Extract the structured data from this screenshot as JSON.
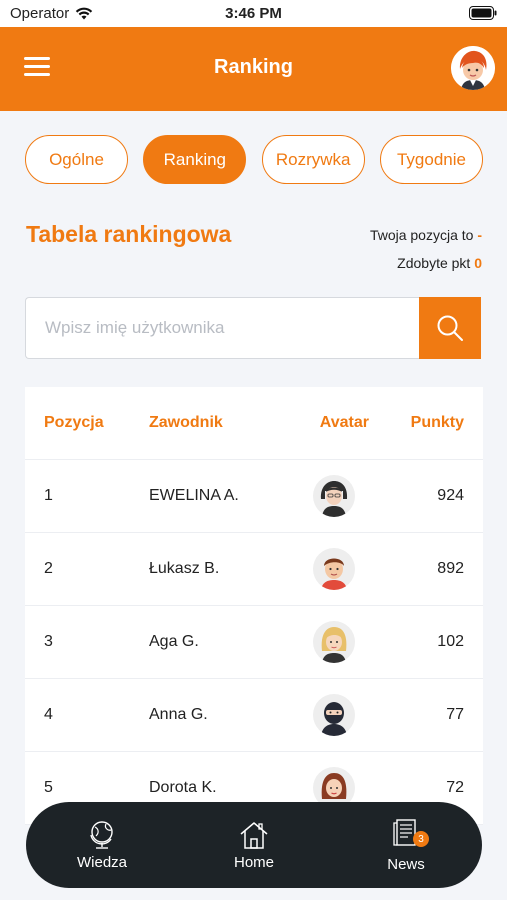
{
  "status_bar": {
    "carrier": "Operator",
    "time": "3:46 PM"
  },
  "header": {
    "title": "Ranking"
  },
  "tabs": [
    {
      "label": "Ogólne",
      "active": false
    },
    {
      "label": "Ranking",
      "active": true
    },
    {
      "label": "Rozrywka",
      "active": false
    },
    {
      "label": "Tygodnie",
      "active": false
    }
  ],
  "section": {
    "title": "Tabela rankingowa",
    "position_label": "Twoja pozycja to",
    "position_value": "-",
    "points_label": "Zdobyte pkt",
    "points_value": "0"
  },
  "search": {
    "placeholder": "Wpisz imię użytkownika",
    "value": ""
  },
  "table": {
    "headers": {
      "position": "Pozycja",
      "player": "Zawodnik",
      "avatar": "Avatar",
      "points": "Punkty"
    },
    "rows": [
      {
        "position": "1",
        "player": "EWELINA A.",
        "points": "924",
        "avatar": "woman-dark-hair-avatar"
      },
      {
        "position": "2",
        "player": "Łukasz B.",
        "points": "892",
        "avatar": "man-red-hair-avatar"
      },
      {
        "position": "3",
        "player": "Aga G.",
        "points": "102",
        "avatar": "woman-blonde-avatar"
      },
      {
        "position": "4",
        "player": "Anna G.",
        "points": "77",
        "avatar": "ninja-avatar"
      },
      {
        "position": "5",
        "player": "Dorota K.",
        "points": "72",
        "avatar": "woman-brown-hair-avatar"
      }
    ]
  },
  "bottom_nav": [
    {
      "label": "Wiedza",
      "icon": "globe-icon"
    },
    {
      "label": "Home",
      "icon": "home-icon"
    },
    {
      "label": "News",
      "icon": "newspaper-icon",
      "badge": "3"
    }
  ],
  "colors": {
    "accent": "#f07a12",
    "nav_bg": "#1d2327",
    "page_bg": "#f3f5f9"
  }
}
